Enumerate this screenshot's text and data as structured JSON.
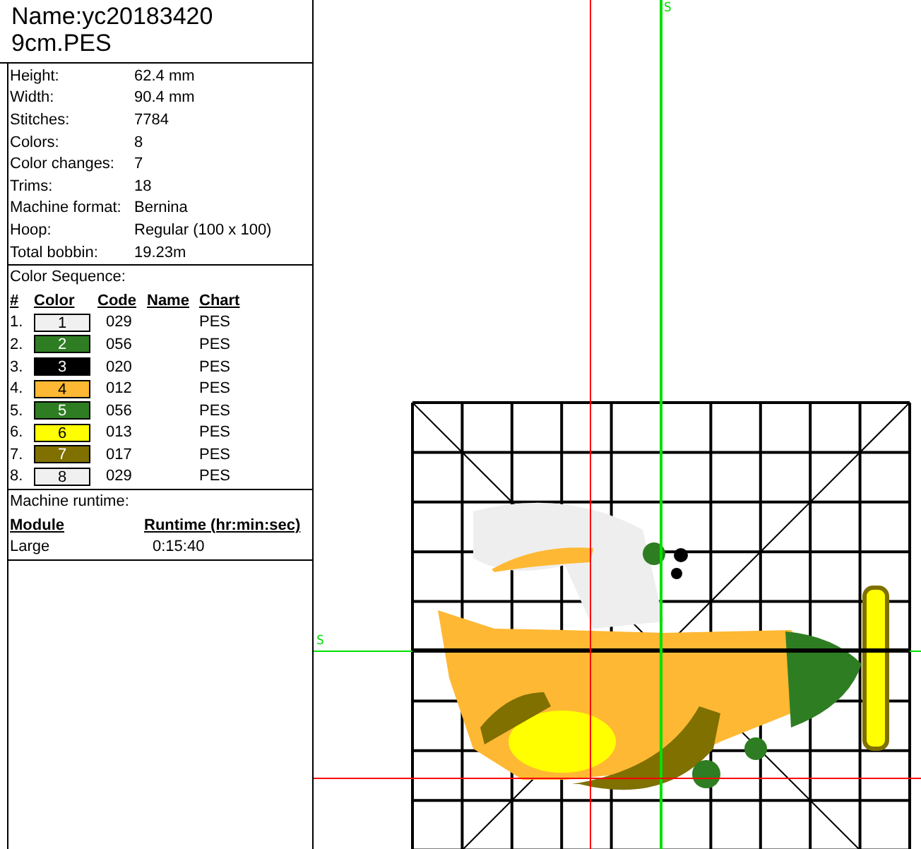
{
  "design": {
    "name_lines": [
      "Name:yc20183420",
      "9cm.PES"
    ]
  },
  "properties": [
    {
      "label": "Height:",
      "value": "62.4 mm"
    },
    {
      "label": "Width:",
      "value": "90.4 mm"
    },
    {
      "label": "Stitches:",
      "value": "7784"
    },
    {
      "label": "Colors:",
      "value": "8"
    },
    {
      "label": "Color changes:",
      "value": "7"
    },
    {
      "label": "Trims:",
      "value": "18"
    },
    {
      "label": "Machine format:",
      "value": "Bernina"
    },
    {
      "label": "Hoop:",
      "value": "Regular (100 x 100)"
    },
    {
      "label": "Total bobbin:",
      "value": "19.23m"
    }
  ],
  "color_sequence": {
    "title": "Color Sequence:",
    "columns": [
      "#",
      "Color",
      "Code",
      "Name",
      "Chart"
    ],
    "rows": [
      {
        "index": "1.",
        "swatch": "1",
        "color": "#f0f0f0",
        "code": "029",
        "chart": "PES"
      },
      {
        "index": "2.",
        "swatch": "2",
        "color": "#2e7d22",
        "code": "056",
        "chart": "PES"
      },
      {
        "index": "3.",
        "swatch": "3",
        "color": "#000000",
        "code": "020",
        "chart": "PES"
      },
      {
        "index": "4.",
        "swatch": "4",
        "color": "#ffb833",
        "code": "012",
        "chart": "PES"
      },
      {
        "index": "5.",
        "swatch": "5",
        "color": "#2e7d22",
        "code": "056",
        "chart": "PES"
      },
      {
        "index": "6.",
        "swatch": "6",
        "color": "#ffff00",
        "code": "013",
        "chart": "PES"
      },
      {
        "index": "7.",
        "swatch": "7",
        "color": "#7f7000",
        "code": "017",
        "chart": "PES"
      },
      {
        "index": "8.",
        "swatch": "8",
        "color": "#f0f0f0",
        "code": "029",
        "chart": "PES"
      }
    ]
  },
  "runtime": {
    "title": "Machine runtime:",
    "columns": [
      "Module",
      "Runtime (hr:min:sec)"
    ],
    "rows": [
      {
        "module": "Large",
        "runtime": "0:15:40"
      }
    ]
  },
  "canvas": {
    "vertical_start_label": "S",
    "horizontal_start_label": "S"
  }
}
